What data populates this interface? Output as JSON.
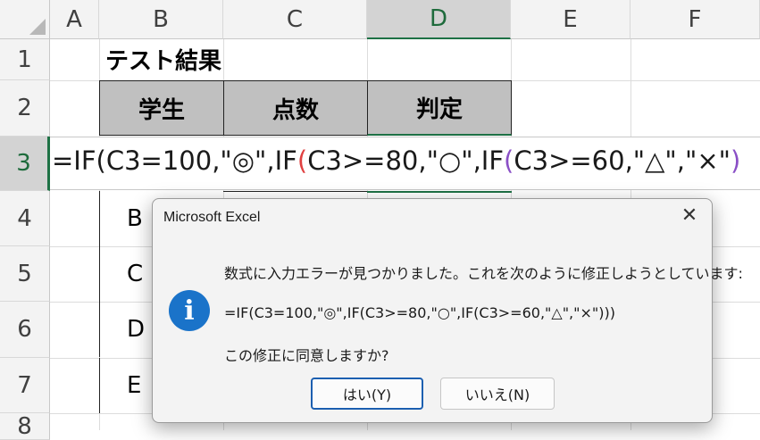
{
  "columns": [
    "A",
    "B",
    "C",
    "D",
    "E",
    "F"
  ],
  "rows": [
    "1",
    "2",
    "3",
    "4",
    "5",
    "6",
    "7",
    "8"
  ],
  "sheet": {
    "title": "テスト結果",
    "headers": [
      "学生",
      "点数",
      "判定"
    ],
    "students": [
      "B",
      "C",
      "D",
      "E"
    ]
  },
  "formula": {
    "seg1": "=IF(C3=100,\"◎\",IF",
    "paren1": "(",
    "seg2": "C3>=80,\"○\",IF",
    "paren2": "(",
    "seg3": "C3>=60,\"△\",\"×\"",
    "paren3": ")"
  },
  "dialog": {
    "title": "Microsoft Excel",
    "message": "数式に入力エラーが見つかりました。これを次のように修正しようとしています:",
    "corrected_formula": "=IF(C3=100,\"◎\",IF(C3>=80,\"○\",IF(C3>=60,\"△\",\"×\")))",
    "question": "この修正に同意しますか?",
    "yes_label": "はい(Y)",
    "no_label": "いいえ(N)"
  },
  "colors": {
    "accent": "#1e7145",
    "header_fill": "#c0c0c0",
    "info": "#1a73c9"
  }
}
